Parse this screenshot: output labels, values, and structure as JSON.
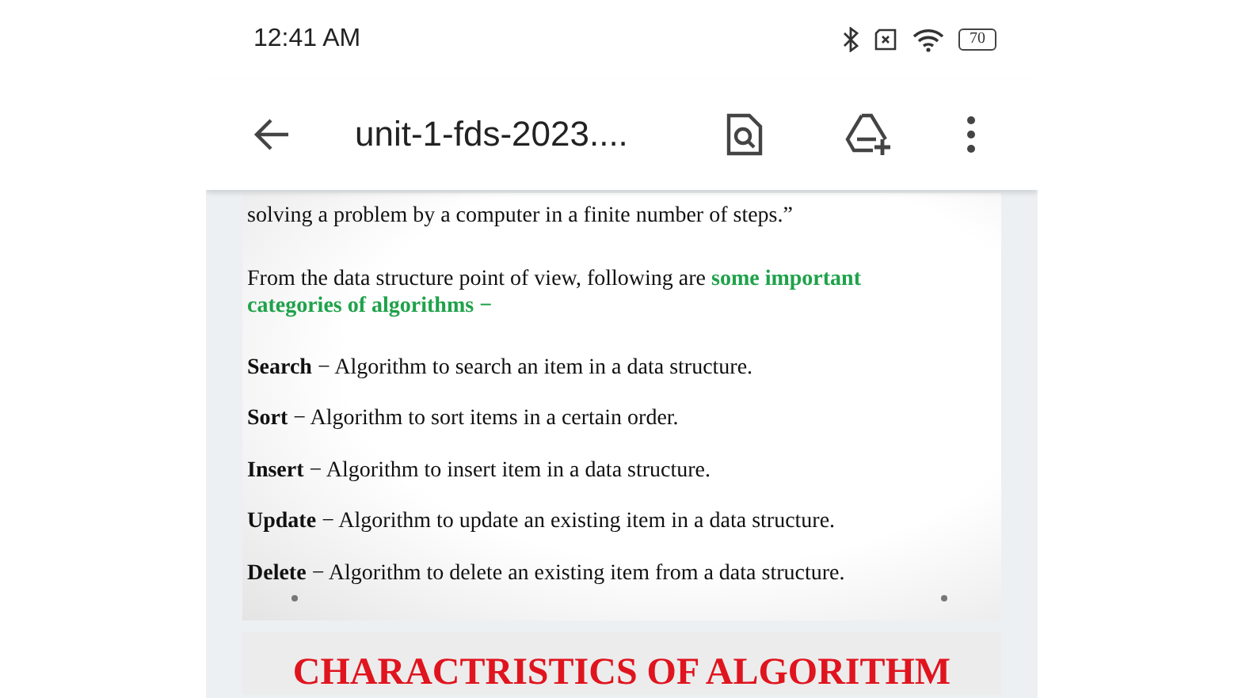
{
  "status_bar": {
    "time": "12:41 AM",
    "battery_text": "70"
  },
  "app_bar": {
    "title": "unit-1-fds-2023...."
  },
  "document": {
    "slides": [
      {
        "kind": "list",
        "intro_line": "solving a problem by a computer in a finite number of steps.”",
        "paragraph": {
          "text": "From the data structure point of view, following are ",
          "highlight": "some important categories of algorithms −"
        },
        "items": [
          {
            "term": "Search",
            "desc": "− Algorithm to search an item in a data structure."
          },
          {
            "term": "Sort",
            "desc": "− Algorithm to sort items in a certain order."
          },
          {
            "term": "Insert",
            "desc": "− Algorithm to insert item in a data structure."
          },
          {
            "term": "Update",
            "desc": "− Algorithm to update an existing item in a data structure."
          },
          {
            "term": "Delete",
            "desc": "− Algorithm to delete an existing item from a data structure."
          }
        ]
      },
      {
        "kind": "title",
        "title": "CHARACTRISTICS OF ALGORITHM"
      }
    ]
  }
}
